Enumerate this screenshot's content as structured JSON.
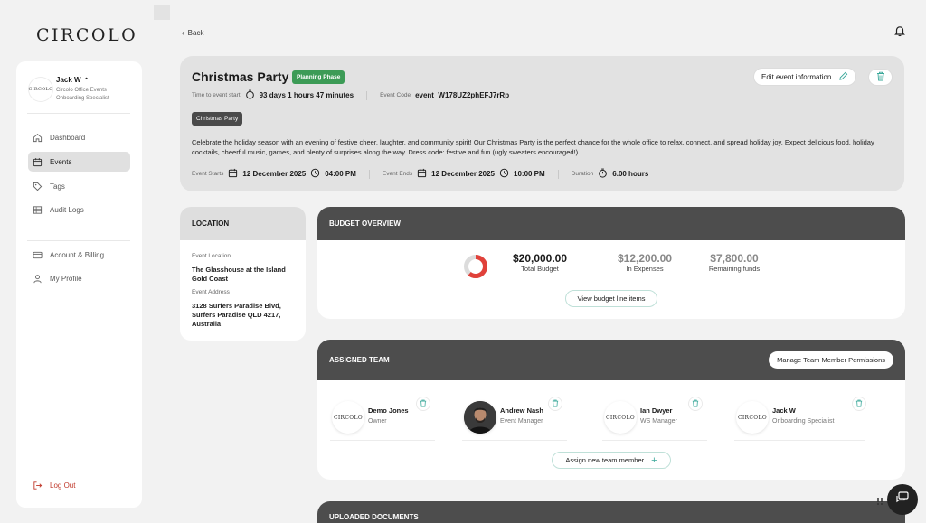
{
  "brand": {
    "logo_text": "CIRCOLO"
  },
  "sidebar": {
    "user": {
      "name": "Jack W",
      "org": "Circolo Office Events",
      "role": "Onboarding Specialist",
      "avatar_text": "CIRCOLO"
    },
    "items": [
      {
        "label": "Dashboard",
        "icon": "home-icon"
      },
      {
        "label": "Events",
        "icon": "calendar-icon",
        "active": true
      },
      {
        "label": "Tags",
        "icon": "tag-icon"
      },
      {
        "label": "Audit Logs",
        "icon": "table-icon"
      },
      {
        "label": "Account & Billing",
        "icon": "card-icon"
      },
      {
        "label": "My Profile",
        "icon": "user-icon"
      }
    ],
    "logout_label": "Log Out"
  },
  "header": {
    "back_label": "Back"
  },
  "event": {
    "title": "Christmas Party",
    "phase": "Planning Phase",
    "edit_label": "Edit event information",
    "time_to_start_label": "Time to event start",
    "time_to_start_value": "93 days 1 hours 47 minutes",
    "code_label": "Event Code",
    "code_value": "event_W178UZ2phEFJ7rRp",
    "tag": "Christmas Party",
    "description": "Celebrate the holiday season with an evening of festive cheer, laughter, and community spirit! Our Christmas Party is the perfect chance for the whole office to relax, connect, and spread holiday joy. Expect delicious food, holiday cocktails, cheerful music, games, and plenty of surprises along the way. Dress code: festive and fun (ugly sweaters encouraged!).",
    "starts_label": "Event Starts",
    "starts_date": "12 December 2025",
    "starts_time": "04:00 PM",
    "ends_label": "Event Ends",
    "ends_date": "12 December 2025",
    "ends_time": "10:00 PM",
    "duration_label": "Duration",
    "duration_value": "6.00 hours"
  },
  "location": {
    "title": "LOCATION",
    "event_location_label": "Event Location",
    "event_location_value": "The Glasshouse at the Island Gold Coast",
    "address_label": "Event Address",
    "address_value": "3128 Surfers Paradise Blvd, Surfers Paradise QLD 4217, Australia"
  },
  "budget": {
    "title": "BUDGET OVERVIEW",
    "total_value": "$20,000.00",
    "total_label": "Total Budget",
    "expenses_value": "$12,200.00",
    "expenses_label": "In Expenses",
    "remaining_value": "$7,800.00",
    "remaining_label": "Remaining funds",
    "expense_fraction": 0.61,
    "view_label": "View budget line items",
    "colors": {
      "expense": "#e0413a",
      "remaining": "#dcdcdc"
    }
  },
  "team": {
    "title": "ASSIGNED TEAM",
    "manage_label": "Manage Team Member Permissions",
    "members": [
      {
        "name": "Demo Jones",
        "role": "Owner",
        "avatar_text": "CIRCOLO"
      },
      {
        "name": "Andrew Nash",
        "role": "Event Manager",
        "avatar_text": ""
      },
      {
        "name": "Ian Dwyer",
        "role": "WS Manager",
        "avatar_text": "CIRCOLO"
      },
      {
        "name": "Jack W",
        "role": "Onboarding Specialist",
        "avatar_text": "CIRCOLO"
      }
    ],
    "assign_label": "Assign new team member"
  },
  "documents": {
    "title": "UPLOADED DOCUMENTS"
  },
  "colors": {
    "phase_badge": "#3c9b56",
    "header_dark": "#4d4d4d",
    "accent_teal": "#3aa89a",
    "logout": "#c0392b"
  }
}
